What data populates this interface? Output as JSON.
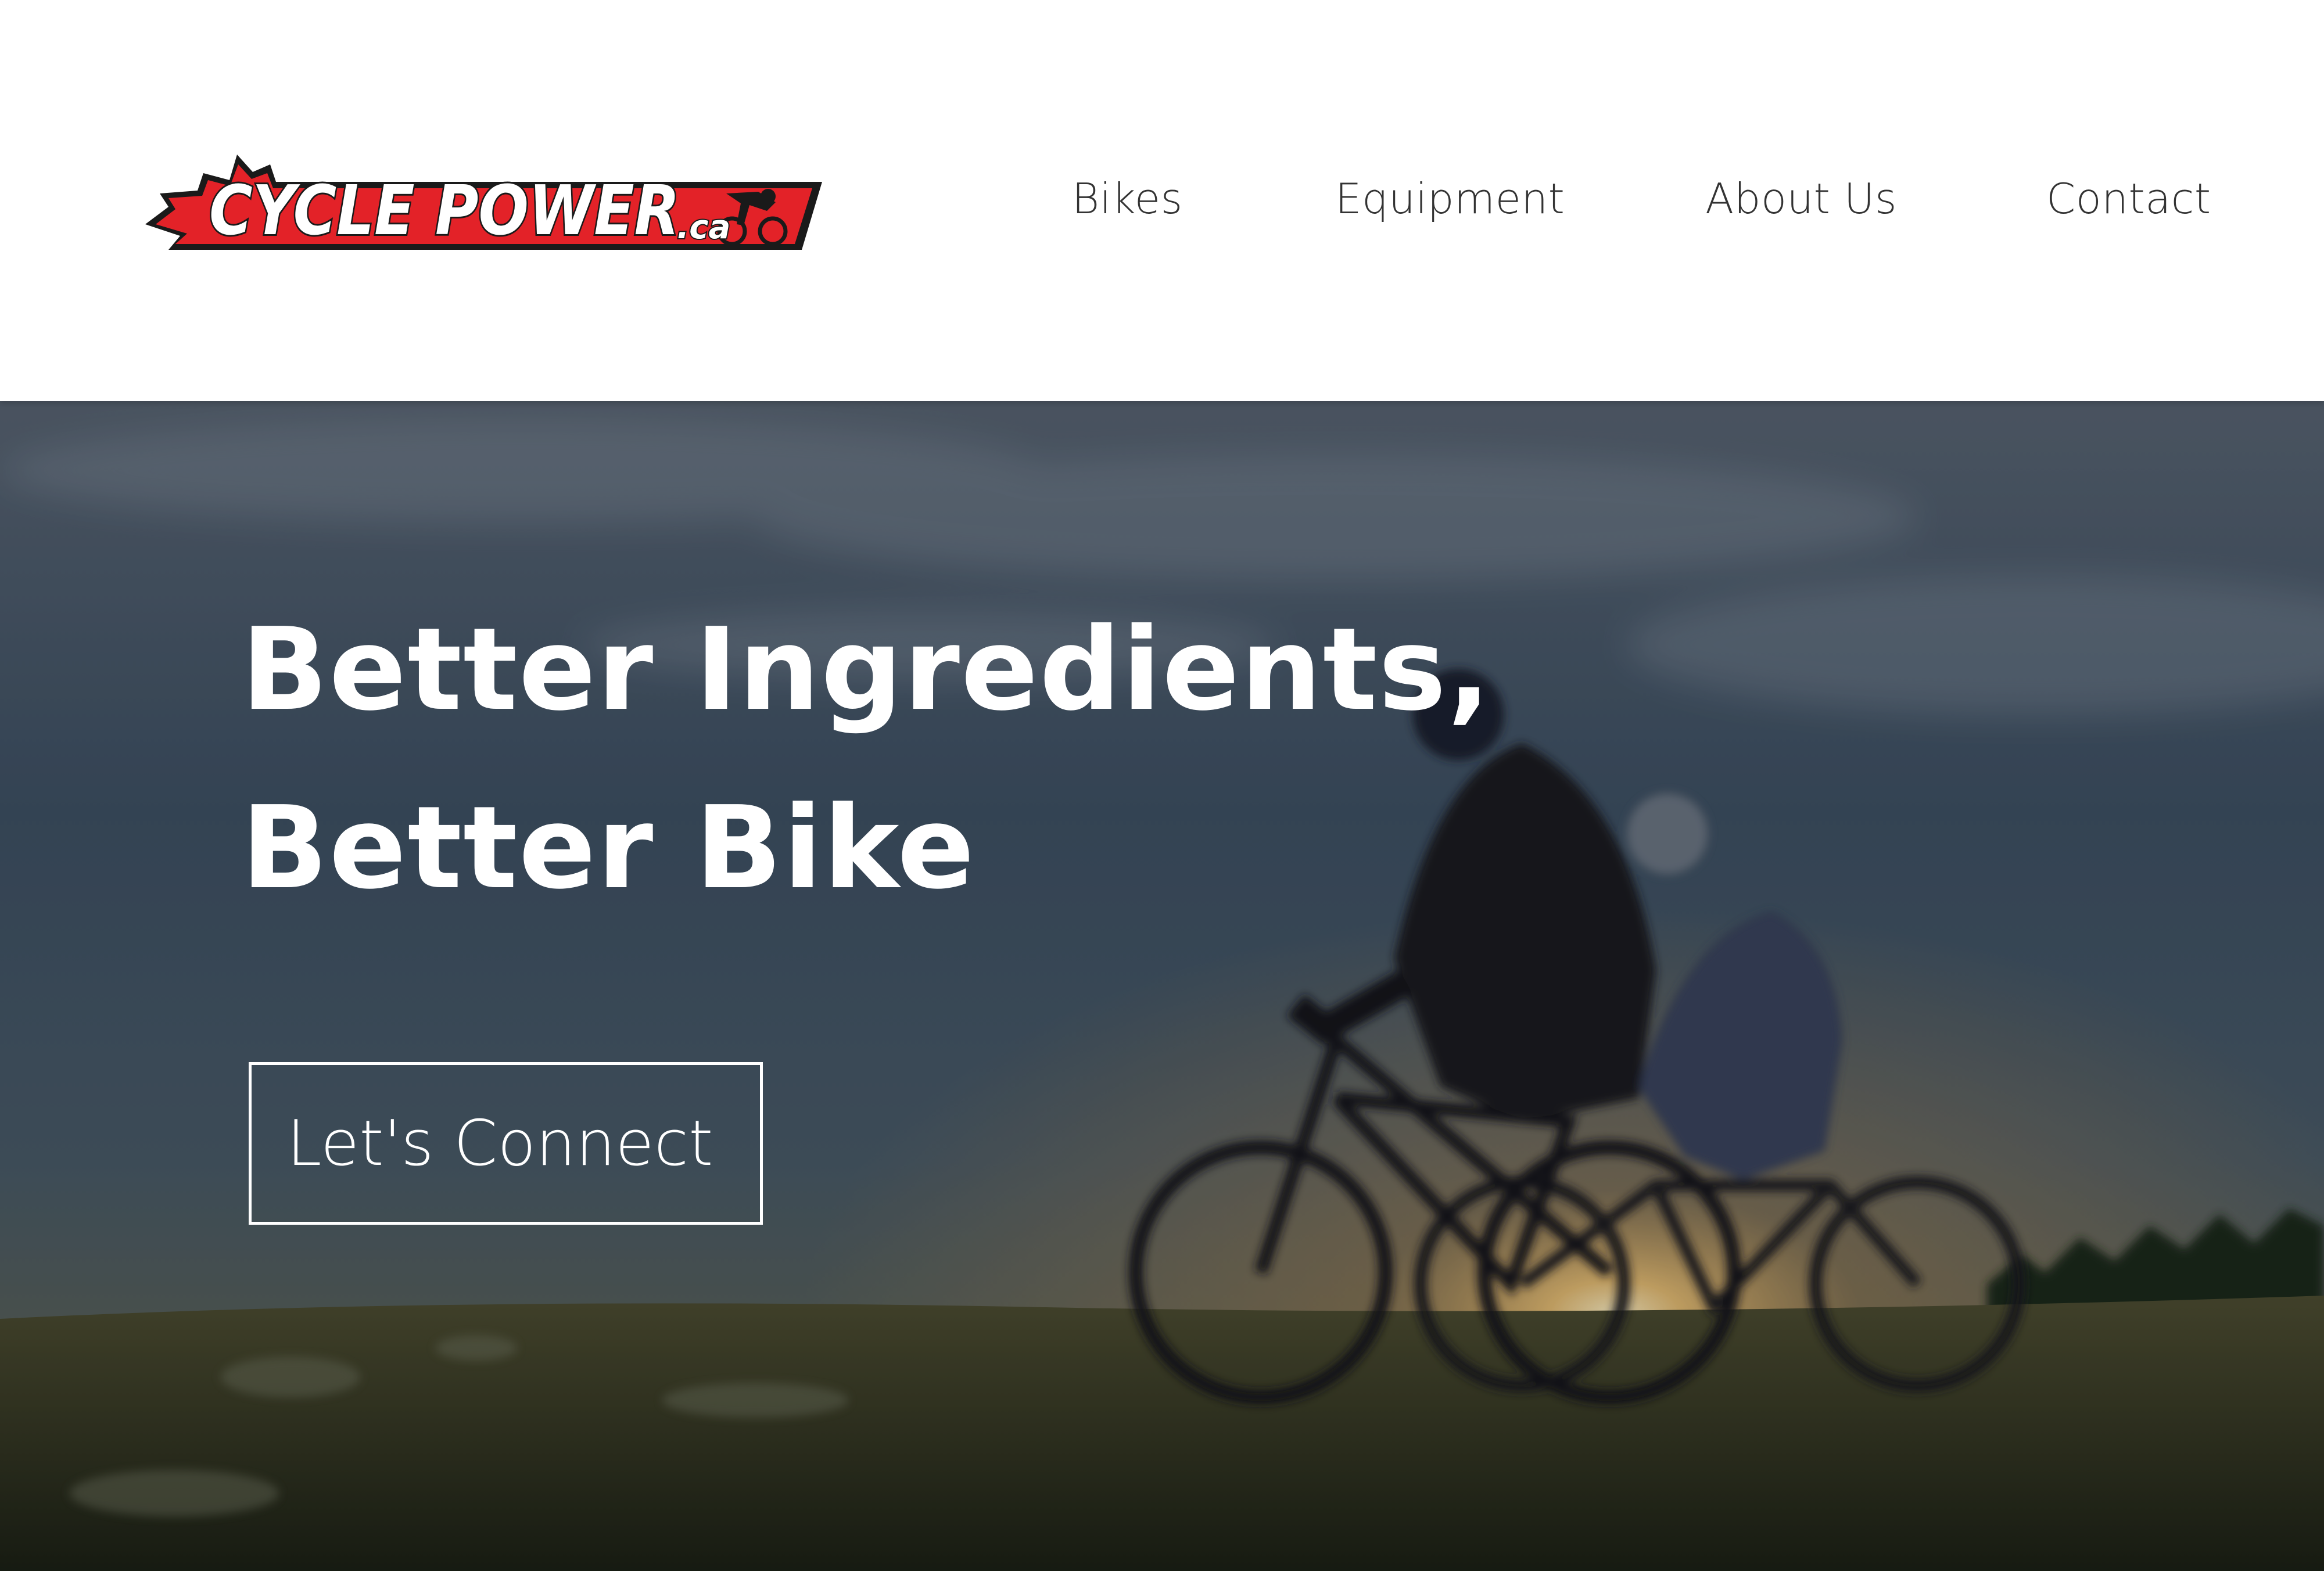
{
  "brand": {
    "logo_text": "CYCLE POWER",
    "logo_suffix": ".ca",
    "colors": {
      "red": "#e32228",
      "black": "#1a1a1a",
      "white": "#ffffff"
    }
  },
  "nav": {
    "items": [
      {
        "label": "Bikes"
      },
      {
        "label": "Equipment"
      },
      {
        "label": "About Us"
      },
      {
        "label": "Contact"
      }
    ]
  },
  "hero": {
    "headline_line1": "Better Ingredients,",
    "headline_line2": "Better Bike",
    "cta_label": "Let's Connect",
    "image_subject": "two-cyclists-silhouette-at-sunset"
  }
}
